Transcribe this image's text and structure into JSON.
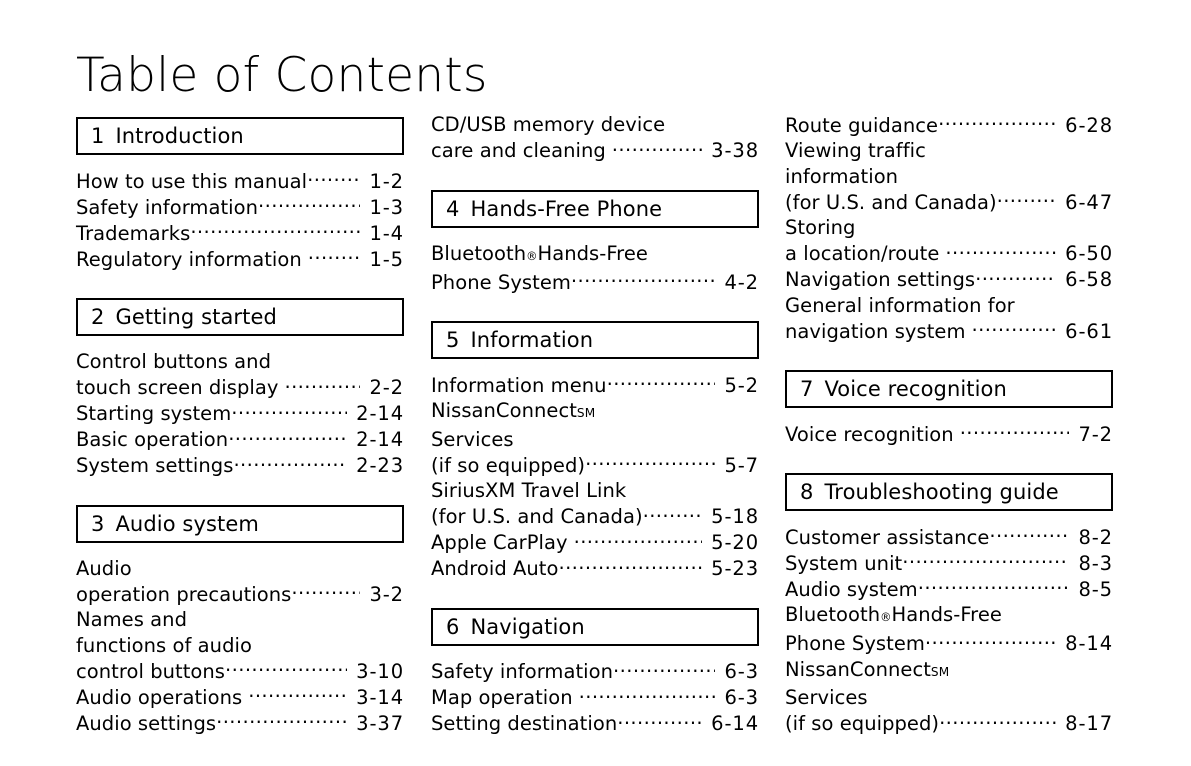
{
  "page": {
    "title": "Table of Contents"
  },
  "columns": [
    {
      "id": "column-1",
      "blocks": [
        {
          "type": "section",
          "number": "1",
          "name": "Introduction",
          "entries": [
            {
              "lines": [
                {
                  "text": "How to use this manual",
                  "leader": true,
                  "page": "1-2"
                }
              ]
            },
            {
              "lines": [
                {
                  "text": "Safety information",
                  "leader": true,
                  "page": "1-3"
                }
              ]
            },
            {
              "lines": [
                {
                  "text": "Trademarks",
                  "leader": true,
                  "page": "1-4"
                }
              ]
            },
            {
              "lines": [
                {
                  "text": "Regulatory information",
                  "space": true,
                  "leader": true,
                  "page": "1-5"
                }
              ]
            }
          ]
        },
        {
          "type": "section",
          "number": "2",
          "name": "Getting started",
          "entries": [
            {
              "lines": [
                {
                  "text": "Control buttons and"
                },
                {
                  "text": "touch screen display",
                  "space": true,
                  "leader": true,
                  "page": "2-2"
                }
              ]
            },
            {
              "lines": [
                {
                  "text": "Starting system",
                  "leader": true,
                  "page": "2-14"
                }
              ]
            },
            {
              "lines": [
                {
                  "text": "Basic operation",
                  "leader": true,
                  "page": "2-14"
                }
              ]
            },
            {
              "lines": [
                {
                  "text": "System settings",
                  "leader": true,
                  "page": "2-23"
                }
              ]
            }
          ]
        },
        {
          "type": "section",
          "number": "3",
          "name": "Audio system",
          "entries": [
            {
              "lines": [
                {
                  "text": "Audio"
                },
                {
                  "text": "operation precautions",
                  "leader": true,
                  "page": "3-2"
                }
              ]
            },
            {
              "lines": [
                {
                  "text": "Names and"
                },
                {
                  "text": "functions of audio"
                },
                {
                  "text": "control buttons",
                  "leader": true,
                  "page": "3-10"
                }
              ]
            },
            {
              "lines": [
                {
                  "text": "Audio operations",
                  "space": true,
                  "leader": true,
                  "page": "3-14"
                }
              ]
            },
            {
              "lines": [
                {
                  "text": "Audio settings",
                  "leader": true,
                  "page": "3-37"
                }
              ]
            }
          ]
        }
      ]
    },
    {
      "id": "column-2",
      "blocks": [
        {
          "type": "continued",
          "entries": [
            {
              "lines": [
                {
                  "text": "CD/USB memory device"
                },
                {
                  "text": "care and cleaning",
                  "space": true,
                  "leader": true,
                  "page": "3-38"
                }
              ]
            }
          ]
        },
        {
          "type": "section",
          "number": "4",
          "name": "Hands-Free Phone",
          "entries": [
            {
              "lines": [
                {
                  "text": "Bluetooth",
                  "sup": "®",
                  "suffix": " Hands-Free"
                },
                {
                  "text": "Phone System",
                  "leader": true,
                  "page": "4-2"
                }
              ]
            }
          ]
        },
        {
          "type": "section",
          "number": "5",
          "name": "Information",
          "entries": [
            {
              "lines": [
                {
                  "text": "Information menu",
                  "leader": true,
                  "page": "5-2"
                }
              ]
            },
            {
              "lines": [
                {
                  "text": "NissanConnect",
                  "sup": "SM"
                },
                {
                  "text": "Services"
                },
                {
                  "text": "(if so equipped)",
                  "leader": true,
                  "page": "5-7"
                }
              ]
            },
            {
              "lines": [
                {
                  "text": "SiriusXM Travel Link"
                },
                {
                  "text": "(for U.S. and Canada)",
                  "leader": true,
                  "page": "5-18"
                }
              ]
            },
            {
              "lines": [
                {
                  "text": "Apple CarPlay",
                  "space": true,
                  "leader": true,
                  "page": "5-20"
                }
              ]
            },
            {
              "lines": [
                {
                  "text": "Android Auto",
                  "leader": true,
                  "page": "5-23"
                }
              ]
            }
          ]
        },
        {
          "type": "section",
          "number": "6",
          "name": "Navigation",
          "entries": [
            {
              "lines": [
                {
                  "text": "Safety information",
                  "leader": true,
                  "page": "6-3"
                }
              ]
            },
            {
              "lines": [
                {
                  "text": "Map operation",
                  "space": true,
                  "leader": true,
                  "page": "6-3"
                }
              ]
            },
            {
              "lines": [
                {
                  "text": "Setting destination",
                  "leader": true,
                  "page": "6-14"
                }
              ]
            }
          ]
        }
      ]
    },
    {
      "id": "column-3",
      "blocks": [
        {
          "type": "continued",
          "entries": [
            {
              "lines": [
                {
                  "text": "Route guidance",
                  "leader": true,
                  "page": "6-28"
                }
              ]
            },
            {
              "lines": [
                {
                  "text": "Viewing traffic"
                },
                {
                  "text": "information"
                },
                {
                  "text": "(for U.S. and Canada)",
                  "leader": true,
                  "page": "6-47"
                }
              ]
            },
            {
              "lines": [
                {
                  "text": "Storing"
                },
                {
                  "text": "a location/route",
                  "space": true,
                  "leader": true,
                  "page": "6-50"
                }
              ]
            },
            {
              "lines": [
                {
                  "text": "Navigation settings",
                  "leader": true,
                  "page": "6-58"
                }
              ]
            },
            {
              "lines": [
                {
                  "text": "General information for"
                },
                {
                  "text": "navigation system",
                  "space": true,
                  "leader": true,
                  "page": "6-61"
                }
              ]
            }
          ]
        },
        {
          "type": "section",
          "number": "7",
          "name": "Voice recognition",
          "entries": [
            {
              "lines": [
                {
                  "text": "Voice recognition",
                  "space": true,
                  "leader": true,
                  "page": "7-2"
                }
              ]
            }
          ]
        },
        {
          "type": "section",
          "number": "8",
          "name": "Troubleshooting guide",
          "entries": [
            {
              "lines": [
                {
                  "text": "Customer assistance",
                  "leader": true,
                  "page": "8-2"
                }
              ]
            },
            {
              "lines": [
                {
                  "text": "System unit",
                  "leader": true,
                  "page": "8-3"
                }
              ]
            },
            {
              "lines": [
                {
                  "text": "Audio system",
                  "leader": true,
                  "page": "8-5"
                }
              ]
            },
            {
              "lines": [
                {
                  "text": "Bluetooth",
                  "sup": "®",
                  "suffix": " Hands-Free"
                },
                {
                  "text": "Phone System",
                  "leader": true,
                  "page": "8-14"
                }
              ]
            },
            {
              "lines": [
                {
                  "text": "NissanConnect",
                  "sup": "SM"
                },
                {
                  "text": "Services"
                },
                {
                  "text": "(if so equipped)",
                  "leader": true,
                  "page": "8-17"
                }
              ]
            }
          ]
        }
      ]
    }
  ]
}
